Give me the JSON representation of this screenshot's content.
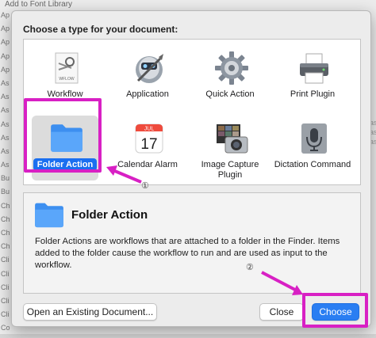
{
  "background": {
    "title": "Add to Font Library",
    "list_items": [
      "Ap",
      "Ap",
      "Ap",
      "Ap",
      "Ap",
      "As",
      "As",
      "As",
      "As",
      "As",
      "As",
      "As",
      "Bu",
      "Bu",
      "Ch",
      "Ch",
      "Ch",
      "Ch",
      "Cli",
      "Cli",
      "Cli",
      "Cli",
      "Cli",
      "Co"
    ],
    "right_items": [
      "as",
      "as",
      "as"
    ]
  },
  "dialog": {
    "title": "Choose a type for your document:",
    "types": [
      {
        "label": "Workflow",
        "icon": "workflow-script-icon",
        "icon_text": "WFLOW"
      },
      {
        "label": "Application",
        "icon": "automator-robot-icon"
      },
      {
        "label": "Quick Action",
        "icon": "gear-icon"
      },
      {
        "label": "Print Plugin",
        "icon": "printer-icon"
      },
      {
        "label": "Folder Action",
        "icon": "folder-icon",
        "selected": true
      },
      {
        "label": "Calendar Alarm",
        "icon": "calendar-icon",
        "month": "JUL",
        "day": "17"
      },
      {
        "label": "Image Capture Plugin",
        "icon": "camera-icon"
      },
      {
        "label": "Dictation Command",
        "icon": "microphone-icon"
      }
    ],
    "description": {
      "title": "Folder Action",
      "text": "Folder Actions are workflows that are attached to a folder in the Finder. Items added to the folder cause the workflow to run and are used as input to the workflow."
    },
    "buttons": {
      "open_existing": "Open an Existing Document...",
      "close": "Close",
      "choose": "Choose"
    }
  },
  "annotations": {
    "step1": "①",
    "step2": "②",
    "highlight_color": "#d820c4"
  }
}
